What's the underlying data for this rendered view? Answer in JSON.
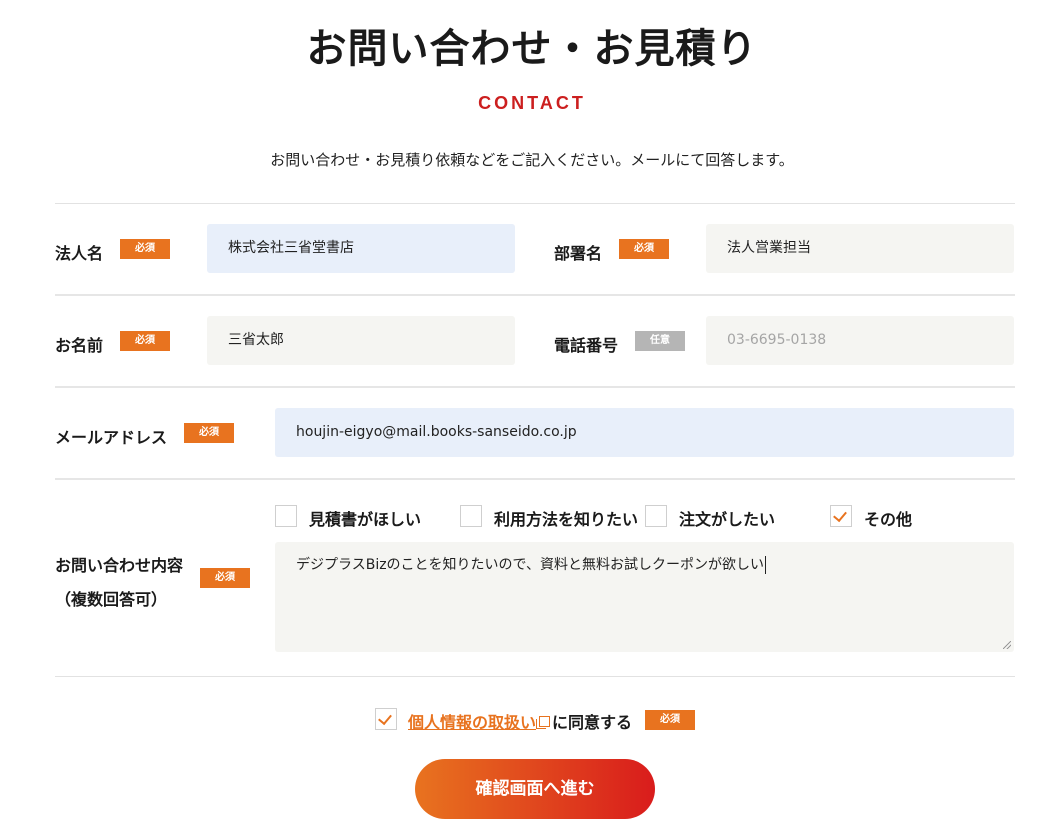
{
  "header": {
    "title": "お問い合わせ・お見積り",
    "subtitle": "CONTACT",
    "intro": "お問い合わせ・お見積り依頼などをご記入ください。メールにて回答します。"
  },
  "badges": {
    "required": "必須",
    "optional": "任意"
  },
  "fields": {
    "company": {
      "label": "法人名",
      "value": "株式会社三省堂書店"
    },
    "department": {
      "label": "部署名",
      "value": "法人営業担当"
    },
    "name": {
      "label": "お名前",
      "value": "三省太郎"
    },
    "phone": {
      "label": "電話番号",
      "placeholder": "03-6695-0138"
    },
    "email": {
      "label": "メールアドレス",
      "value": "houjin-eigyo@mail.books-sanseido.co.jp"
    },
    "inquiry": {
      "label_line1": "お問い合わせ内容",
      "label_line2": "（複数回答可）",
      "options": [
        {
          "label": "見積書がほしい",
          "checked": false
        },
        {
          "label": "利用方法を知りたい",
          "checked": false
        },
        {
          "label": "注文がしたい",
          "checked": false
        },
        {
          "label": "その他",
          "checked": true
        }
      ],
      "message": "デジプラスBizのことを知りたいので、資料と無料お試しクーポンが欲しい"
    }
  },
  "consent": {
    "checked": true,
    "link_text": "個人情報の取扱い",
    "suffix": "に同意する"
  },
  "submit_label": "確認画面へ進む",
  "colors": {
    "accent": "#e8731f",
    "brand_red": "#cc1f1f",
    "field_bg": "#f5f5f2",
    "field_active_bg": "#e8effa"
  }
}
